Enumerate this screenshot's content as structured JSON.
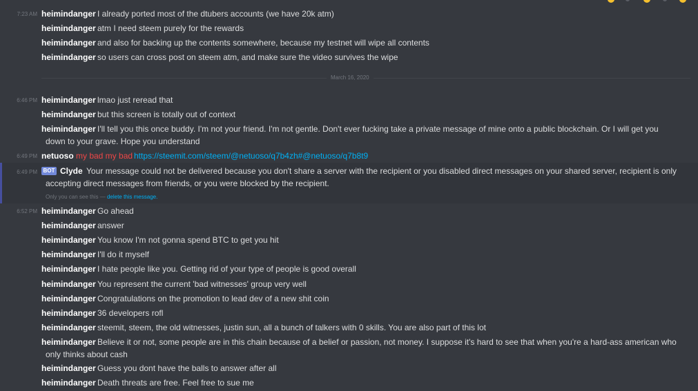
{
  "messages_top": [
    {
      "time": "7:23 AM",
      "author": "heimindanger",
      "text": "I already ported most of the dtubers accounts (we have 20k atm)"
    },
    {
      "author": "heimindanger",
      "text": "atm I need steem purely for the rewards"
    },
    {
      "author": "heimindanger",
      "text": "and also for backing up the contents somewhere, because my testnet will wipe all contents"
    },
    {
      "author": "heimindanger",
      "text": "so users can cross post on steem atm, and make sure the video survives the wipe"
    }
  ],
  "date_divider": "March 16, 2020",
  "messages_mid": [
    {
      "time": "6:46 PM",
      "author": "heimindanger",
      "text": "lmao just reread that"
    },
    {
      "author": "heimindanger",
      "text": "but this screen is totally out of context"
    },
    {
      "author": "heimindanger",
      "text": "I'll tell you this once buddy. I'm not your friend. I'm not gentle. Don't ever fucking take a private message of mine onto a public blockchain. Or I will get you down to your grave. Hope you understand"
    }
  ],
  "netuoso": {
    "time": "6:49 PM",
    "author": "netuoso",
    "red_text": "my bad my bad",
    "link": "https://steemit.com/steem/@netuoso/q7b4zh#@netuoso/q7b8t9"
  },
  "clyde": {
    "time": "6:49 PM",
    "bot_tag": "BOT",
    "author": "Clyde",
    "text": "Your message could not be delivered because you don't share a server with the recipient or you disabled direct messages on your shared server, recipient is only accepting direct messages from friends, or you were blocked by the recipient.",
    "only_you": "Only you can see this — ",
    "delete_link": "delete this message."
  },
  "messages_bottom": [
    {
      "time": "6:52 PM",
      "author": "heimindanger",
      "text": "Go ahead"
    },
    {
      "author": "heimindanger",
      "text": "answer"
    },
    {
      "author": "heimindanger",
      "text": "You know I'm not gonna spend BTC to get you hit"
    },
    {
      "author": "heimindanger",
      "text": "I'll do it myself"
    },
    {
      "author": "heimindanger",
      "text": "I hate people like you. Getting rid of your type of people is good overall"
    },
    {
      "author": "heimindanger",
      "text": "You represent the current 'bad witnesses' group very well"
    },
    {
      "author": "heimindanger",
      "text": "Congratulations on the promotion to lead dev of a new shit coin"
    },
    {
      "author": "heimindanger",
      "text": "36 developers rofl"
    },
    {
      "author": "heimindanger",
      "text": "steemit, steem, the old witnesses, justin sun, all a bunch of talkers with 0 skills. You are also part of this lot"
    },
    {
      "author": "heimindanger",
      "text": "Believe it or not, some people are in this chain because of a belief or passion, not money. I suppose it's hard to see that when you're a hard-ass american who only thinks about cash"
    },
    {
      "author": "heimindanger",
      "text": "Guess you dont have the balls to answer after all"
    },
    {
      "author": "heimindanger",
      "text": "Death threats are free. Feel free to sue me"
    }
  ],
  "colors": {
    "background": "#36393f",
    "author": "#ffffff",
    "text": "#dcddde",
    "muted": "#72767d",
    "link": "#00b0f4",
    "red": "#f04747",
    "bot_tag": "#7289da"
  }
}
